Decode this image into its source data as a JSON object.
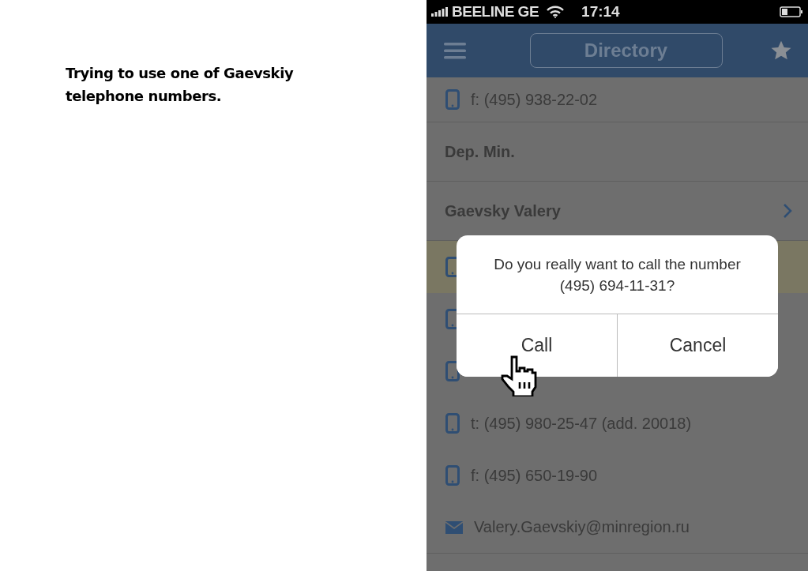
{
  "slide": {
    "caption": "Trying to use one of Gaevskiy telephone numbers."
  },
  "status_bar": {
    "carrier": "BEELINE GE",
    "time": "17:14"
  },
  "nav_bar": {
    "title": "Directory"
  },
  "rows": [
    {
      "kind": "phone",
      "text": "f: (495) 938-22-02",
      "selected": false
    },
    {
      "kind": "header",
      "text": "Dep. Min.",
      "selected": false
    },
    {
      "kind": "person",
      "text": "Gaevsky Valery",
      "selected": false
    },
    {
      "kind": "phone",
      "selected": true
    },
    {
      "kind": "phone",
      "selected": false
    },
    {
      "kind": "phone",
      "selected": false
    },
    {
      "kind": "phone",
      "text": "t: (495) 980-25-47 (add. 20018)",
      "selected": false
    },
    {
      "kind": "phone",
      "text": "f: (495) 650-19-90",
      "selected": false
    },
    {
      "kind": "email",
      "text": "Valery.Gaevskiy@minregion.ru",
      "selected": false
    }
  ],
  "dialog": {
    "message": "Do you really want to call the number (495) 694-11-31?",
    "buttons": [
      "Call",
      "Cancel"
    ]
  }
}
